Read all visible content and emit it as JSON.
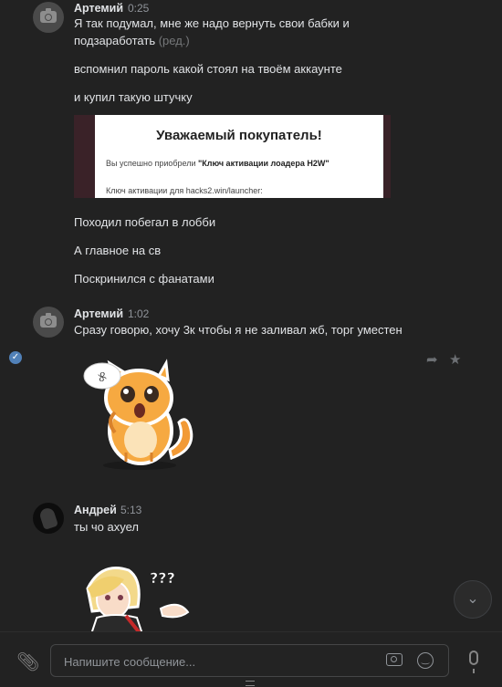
{
  "messages": [
    {
      "author": "Артемий",
      "time": "0:25",
      "lines": [
        "Я так подумал, мне же надо вернуть свои бабки и",
        "подзаработать",
        "вспомнил пароль какой стоял на твоём аккаунте",
        "и купил такую штучку"
      ],
      "edited_label": "(ред.)"
    },
    {
      "photo": {
        "title": "Уважаемый покупатель!",
        "line1_prefix": "Вы успешно приобрели ",
        "line1_bold": "\"Ключ активации лоадера H2W\"",
        "line2": "Ключ активации для hacks2.win/launcher:"
      }
    },
    {
      "lines": [
        "Походил побегал в лобби",
        "А главное на св",
        "Поскринился с фанатами"
      ]
    },
    {
      "author": "Артемий",
      "time": "1:02",
      "lines": [
        "Сразу говорю, хочу 3к чтобы я не заливал жб, торг уместен"
      ]
    },
    {
      "author": "Андрей",
      "time": "5:13",
      "lines": [
        "ты чо ахуел"
      ]
    }
  ],
  "stickers": {
    "cat_bubble": "୫",
    "girl_bubble": "???"
  },
  "composer": {
    "placeholder": "Напишите сообщение..."
  },
  "icons": [
    "camera-icon",
    "check-icon",
    "reply-icon",
    "star-icon",
    "chevron-down-icon",
    "paperclip-icon",
    "emoji-icon",
    "microphone-icon"
  ],
  "colors": {
    "background": "#222222",
    "text": "#e1e3e6",
    "muted": "#8f9399",
    "accent": "#5181b8"
  }
}
